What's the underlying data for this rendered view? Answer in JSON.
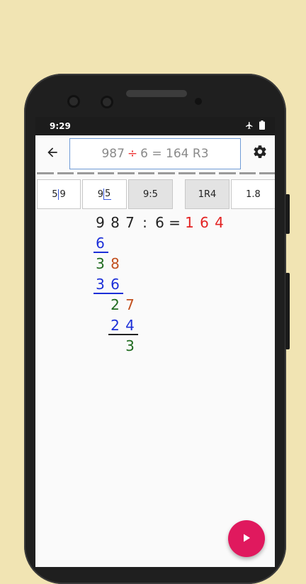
{
  "status": {
    "time": "9:29"
  },
  "expression": {
    "dividend": "987",
    "operator": "÷",
    "rest": "6 = 164 R3"
  },
  "modes": [
    {
      "left": "5",
      "right": "9"
    },
    {
      "left": "9",
      "right": "5"
    },
    {
      "text": "9:5"
    },
    {
      "text": "1R4"
    },
    {
      "text": "1.8"
    }
  ],
  "work": {
    "header": {
      "d1": "9",
      "d2": "8",
      "d3": "7",
      "colon": ":",
      "divisor": "6",
      "eq": "=",
      "q1": "1",
      "q2": "6",
      "q3": "4"
    },
    "step1_sub": "6",
    "step1_rem": {
      "a": "3",
      "b": "8"
    },
    "step2_sub": {
      "a": "3",
      "b": "6"
    },
    "step2_rem": {
      "a": "2",
      "b": "7"
    },
    "step3_sub": {
      "a": "2",
      "b": "4"
    },
    "final_rem": "3"
  },
  "colors": {
    "accent_fab": "#e0195e",
    "quotient": "#e32222",
    "subtrahend": "#1c2fd8",
    "remainder": "#1f6a1f",
    "brought_down": "#c2501e"
  },
  "icons": {
    "back": "arrow-left-icon",
    "settings": "gear-icon",
    "play": "play-icon",
    "airplane": "airplane-icon",
    "battery": "battery-icon"
  }
}
